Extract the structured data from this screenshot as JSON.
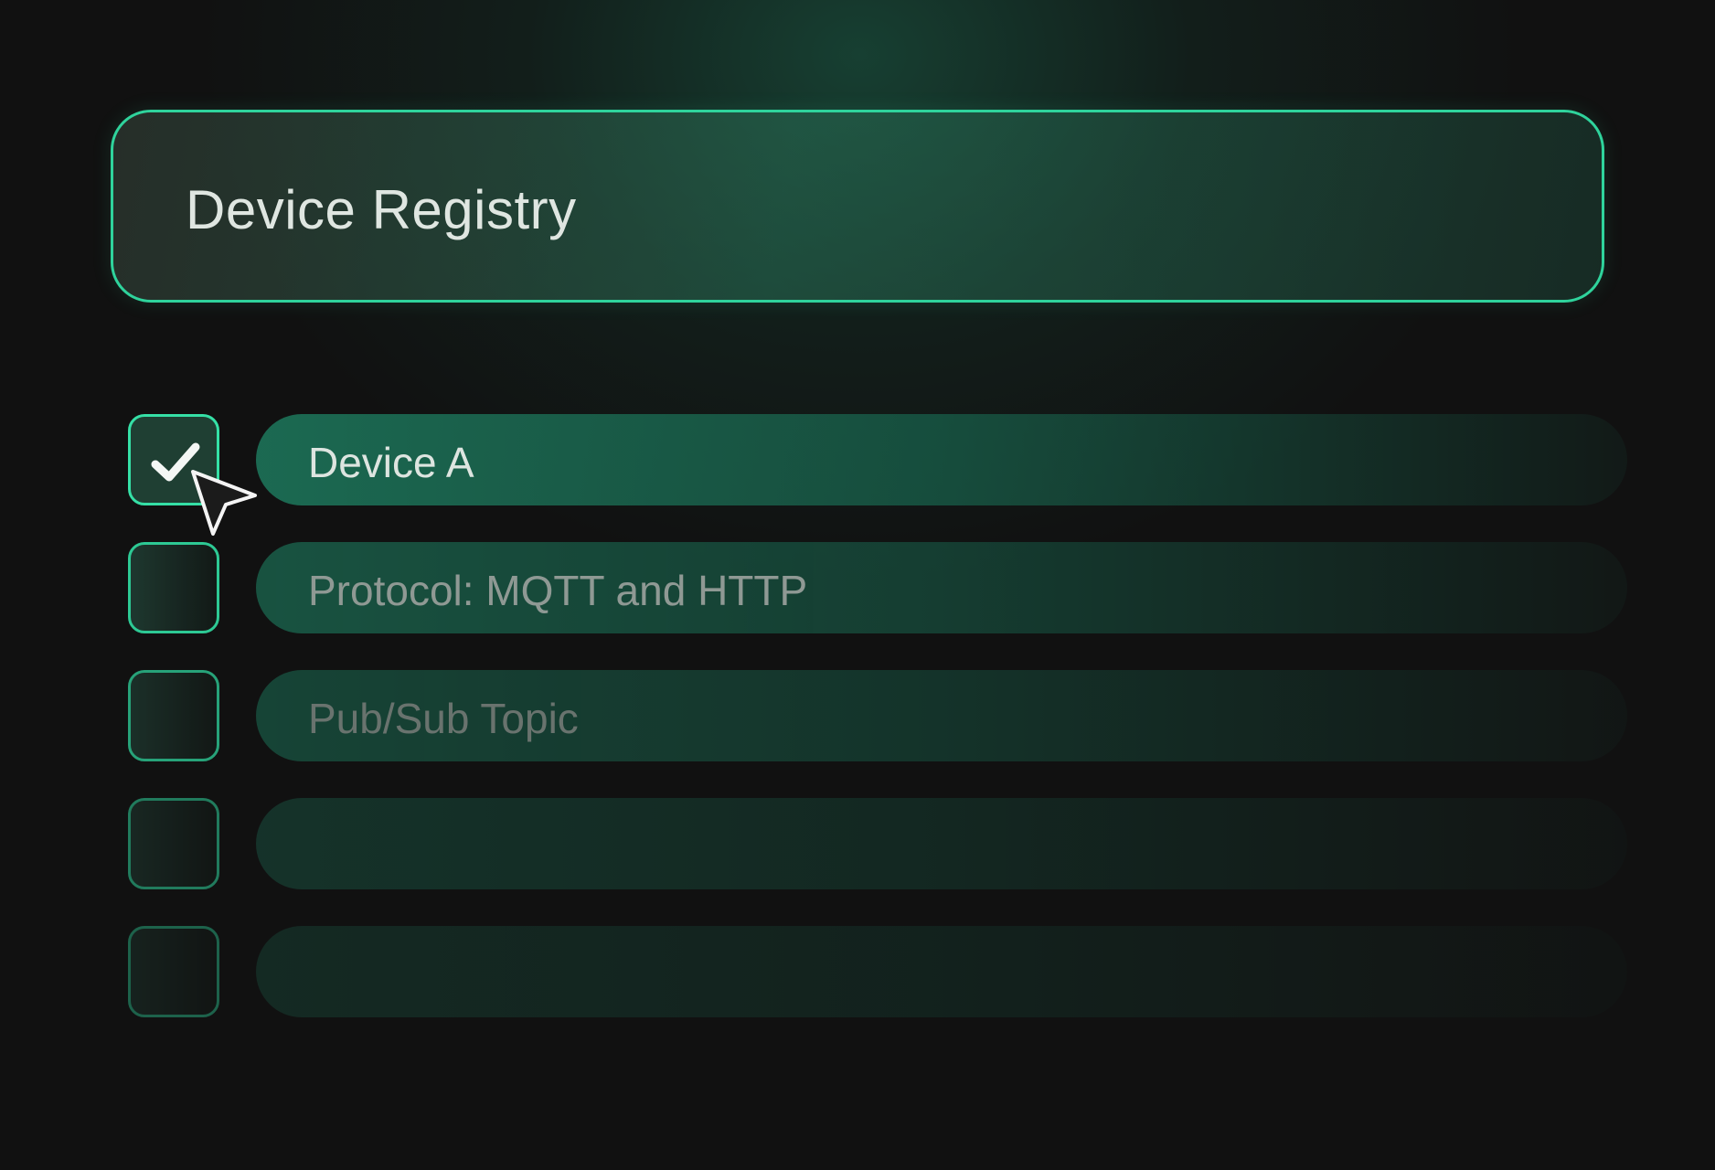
{
  "header": {
    "title": "Device Registry"
  },
  "items": [
    {
      "label": "Device A",
      "checked": true
    },
    {
      "label": "Protocol: MQTT and HTTP",
      "checked": false
    },
    {
      "label": "Pub/Sub Topic",
      "checked": false
    },
    {
      "label": "",
      "checked": false
    },
    {
      "label": "",
      "checked": false
    }
  ],
  "icons": {
    "check": "checkmark-icon",
    "cursor": "cursor-pointer-icon"
  },
  "colors": {
    "accent": "#2fd39c",
    "background": "#111111",
    "bar": "#1c6e55"
  }
}
